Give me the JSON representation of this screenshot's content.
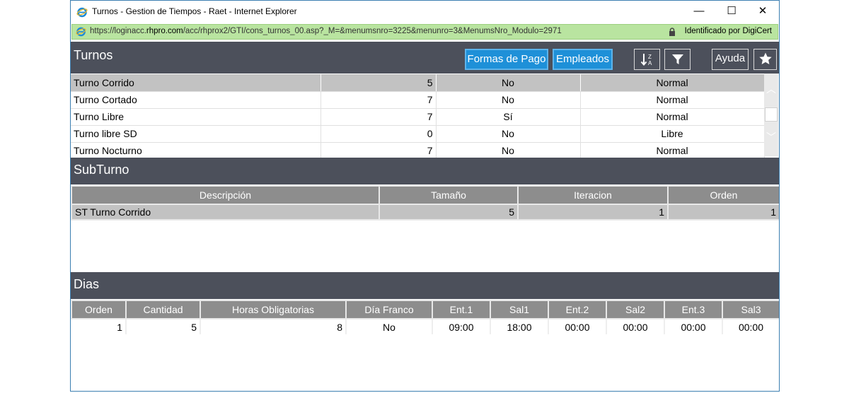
{
  "window": {
    "title": "Turnos - Gestion de Tiempos - Raet - Internet Explorer",
    "minimize": "—",
    "maximize": "☐",
    "close": "✕"
  },
  "address": {
    "url_prefix": "https://loginacc.",
    "url_domain": "rhpro.com",
    "url_path": "/acc/rhprox2/GTI/cons_turnos_00.asp?_M=&menumsnro=3225&menunro=3&MenumsNro_Modulo=2971",
    "certificate": "Identificado por DigiCert"
  },
  "turnos": {
    "title": "Turnos",
    "buttons": {
      "formas_pago": "Formas de Pago",
      "empleados": "Empleados",
      "ayuda": "Ayuda"
    },
    "rows": [
      {
        "name": "Turno Corrido",
        "size": "5",
        "flag": "No",
        "type": "Normal"
      },
      {
        "name": "Turno Cortado",
        "size": "7",
        "flag": "No",
        "type": "Normal"
      },
      {
        "name": "Turno Libre",
        "size": "7",
        "flag": "Sí",
        "type": "Normal"
      },
      {
        "name": "Turno libre SD",
        "size": "0",
        "flag": "No",
        "type": "Libre"
      },
      {
        "name": "Turno Nocturno",
        "size": "7",
        "flag": "No",
        "type": "Normal"
      }
    ]
  },
  "subturno": {
    "title": "SubTurno",
    "headers": [
      "Descripción",
      "Tamaño",
      "Iteracion",
      "Orden"
    ],
    "rows": [
      {
        "descripcion": "ST Turno Corrido",
        "tamano": "5",
        "iteracion": "1",
        "orden": "1"
      }
    ]
  },
  "dias": {
    "title": "Dias",
    "headers": [
      "Orden",
      "Cantidad",
      "Horas Obligatorias",
      "Día Franco",
      "Ent.1",
      "Sal1",
      "Ent.2",
      "Sal2",
      "Ent.3",
      "Sal3"
    ],
    "rows": [
      {
        "orden": "1",
        "cantidad": "5",
        "horas": "8",
        "franco": "No",
        "ent1": "09:00",
        "sal1": "18:00",
        "ent2": "00:00",
        "sal2": "00:00",
        "ent3": "00:00",
        "sal3": "00:00"
      }
    ]
  },
  "colors": {
    "header_bar": "#4c505b",
    "accent_button": "#1e90d8",
    "address_bar": "#b9e4a0",
    "selected_row": "#c2c2c2",
    "table_header": "#8d8d8d"
  }
}
